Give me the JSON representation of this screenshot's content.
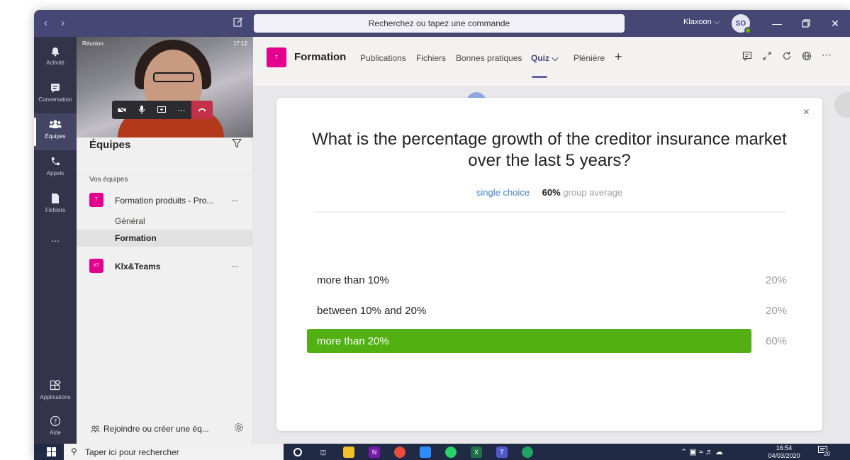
{
  "titlebar": {
    "search_placeholder": "Recherchez ou tapez une commande",
    "tenant": "Klaxoon",
    "avatar_initials": "SO"
  },
  "rail": {
    "items": [
      {
        "label": "Activité",
        "icon": "bell-icon"
      },
      {
        "label": "Conversation",
        "icon": "chat-icon"
      },
      {
        "label": "Équipes",
        "icon": "teams-icon"
      },
      {
        "label": "Appels",
        "icon": "phone-icon"
      },
      {
        "label": "Fichiers",
        "icon": "file-icon"
      },
      {
        "label": "...",
        "icon": "more-icon"
      }
    ],
    "apps_label": "Applications",
    "help_label": "Aide"
  },
  "video": {
    "label": "Réunion",
    "time": "17:12"
  },
  "panel": {
    "title": "Équipes",
    "section_label": "Vos équipes",
    "teams": [
      {
        "tile": "T",
        "name": "Formation produits - Pro...",
        "more": "..."
      },
      {
        "tile": "KT",
        "name": "Klx&Teams",
        "more": "..."
      }
    ],
    "channels": [
      "Général",
      "Formation"
    ],
    "join_label": "Rejoindre ou créer une éq..."
  },
  "channel_header": {
    "tile": "T",
    "name": "Formation",
    "tabs": [
      "Publications",
      "Fichiers",
      "Bonnes pratiques",
      "Quiz ⌵",
      "Plénière"
    ],
    "add": "+"
  },
  "quiz": {
    "question": "What is the percentage growth of the creditor insurance market over the last 5 years?",
    "type": "single choice",
    "average_pct": "60%",
    "average_label": "group average",
    "answers": [
      {
        "label": "more than 10%",
        "pct": "20%",
        "value": 0
      },
      {
        "label": "between 10% and 20%",
        "pct": "20%",
        "value": 0
      },
      {
        "label": "more than 20%",
        "pct": "60%",
        "value": 1
      }
    ],
    "close": "×"
  },
  "taskbar": {
    "search_placeholder": "Taper ici pour rechercher",
    "time": "16:54",
    "date": "04/03/2020",
    "notifications": "20"
  },
  "colors": {
    "titlebar": "#464775",
    "rail": "#33344a",
    "accent": "#6264a7",
    "team_tile": "#e3008c",
    "selected_answer": "#52b012",
    "taskbar": "#202a44"
  }
}
